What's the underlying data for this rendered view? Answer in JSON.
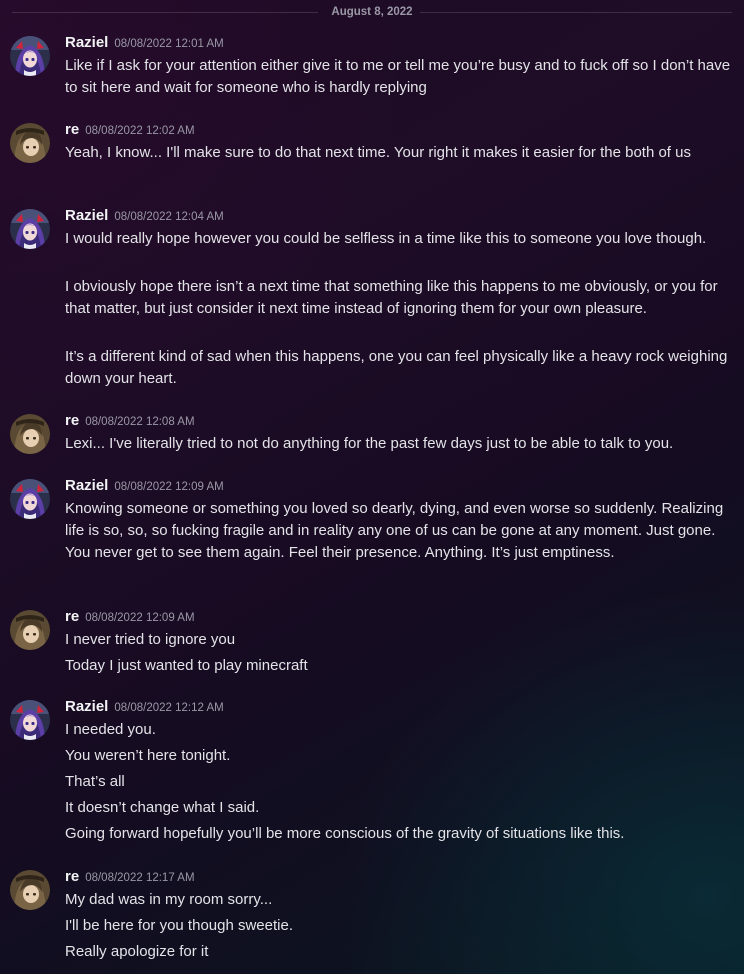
{
  "date_divider": "August 8, 2022",
  "users": {
    "raziel": {
      "name": "Raziel",
      "avatar_icon": "anime-girl-avatar-icon"
    },
    "re": {
      "name": "re",
      "avatar_icon": "anime-character-avatar-icon"
    }
  },
  "groups": [
    {
      "author": "Raziel",
      "timestamp": "08/08/2022 12:01 AM",
      "messages": [
        "Like if I ask for your attention either give it to me or tell me you’re busy and to fuck off so I don’t have to sit here and wait for someone who is hardly replying"
      ]
    },
    {
      "author": "re",
      "timestamp": "08/08/2022 12:02 AM",
      "messages": [
        "Yeah, I know... I'll make sure to do that next time. Your right it makes it easier for the both of us"
      ]
    },
    {
      "author": "Raziel",
      "timestamp": "08/08/2022 12:04 AM",
      "messages": [
        "I would really hope however you could be selfless in a time like this to someone you love though.",
        "I obviously hope there isn’t a next time that something like this happens to me obviously, or you for that matter, but just consider it next time instead of ignoring them for your own pleasure.",
        "It’s a different kind of sad when this happens, one you can feel physically like a heavy rock weighing down your heart."
      ]
    },
    {
      "author": "re",
      "timestamp": "08/08/2022 12:08 AM",
      "messages": [
        "Lexi... I've literally tried to not do anything for the past few days just to be able to talk to you."
      ]
    },
    {
      "author": "Raziel",
      "timestamp": "08/08/2022 12:09 AM",
      "messages": [
        "Knowing someone or something you loved so dearly, dying, and even worse so suddenly. Realizing life is so, so, so fucking fragile and in reality any one of us can be gone at any moment. Just gone. You never get to see them again. Feel their presence. Anything. It’s just emptiness."
      ]
    },
    {
      "author": "re",
      "timestamp": "08/08/2022 12:09 AM",
      "messages": [
        "I never tried to ignore you",
        "Today I just wanted to play minecraft"
      ]
    },
    {
      "author": "Raziel",
      "timestamp": "08/08/2022 12:12 AM",
      "messages": [
        "I needed you.",
        "You weren’t here tonight.",
        "That’s all",
        "It doesn’t change what I said.",
        "Going forward hopefully you’ll be more conscious of the gravity of situations like this."
      ]
    },
    {
      "author": "re",
      "timestamp": "08/08/2022 12:17 AM",
      "messages": [
        "My dad was in my room sorry...",
        "I'll be here for you though sweetie.",
        "Really apologize for it"
      ]
    }
  ]
}
